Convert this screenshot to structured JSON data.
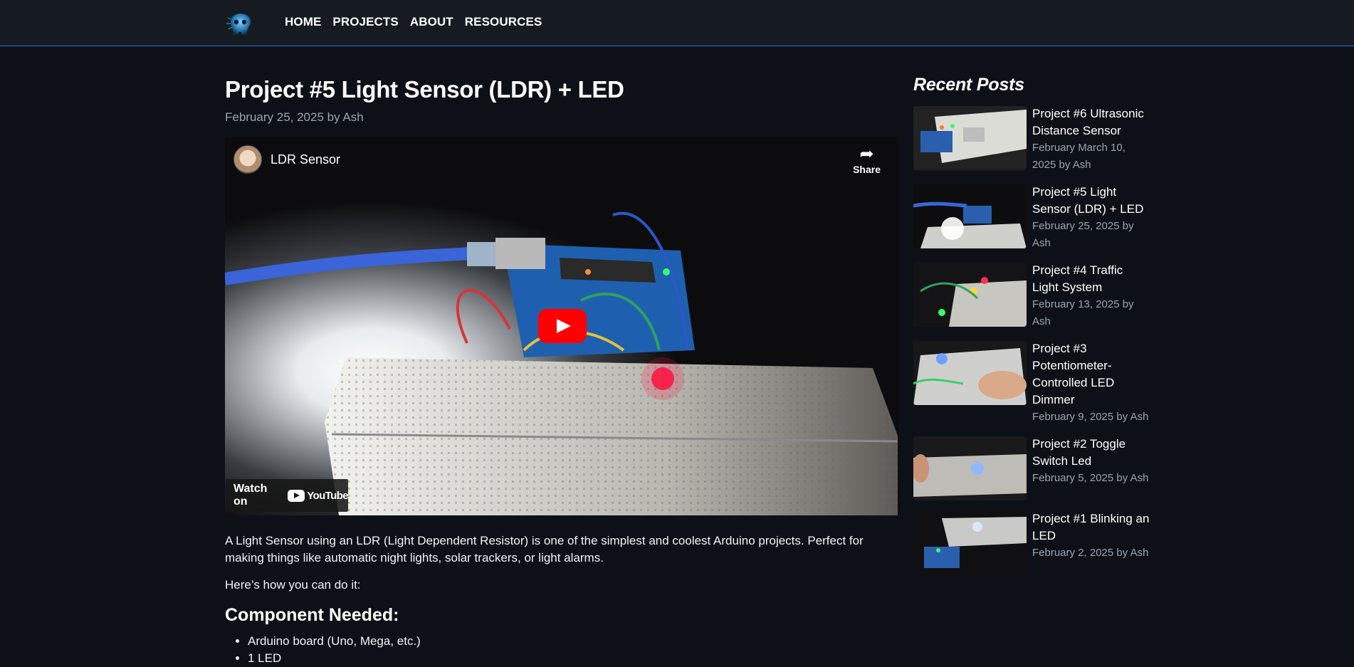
{
  "nav": {
    "logo_icon": "skull-logo-icon",
    "links": [
      "HOME",
      "PROJECTS",
      "ABOUT",
      "RESOURCES"
    ]
  },
  "post": {
    "title": "Project #5 Light Sensor (LDR) + LED",
    "meta": "February 25, 2025 by Ash",
    "video": {
      "title": "LDR Sensor",
      "share_label": "Share",
      "share_icon": "share-arrow-icon",
      "play_icon": "play-icon",
      "watch_on_label": "Watch on",
      "youtube_label": "YouTube"
    },
    "intro": "A Light Sensor using an LDR (Light Dependent Resistor) is one of the simplest and coolest Arduino projects. Perfect for making things like automatic night lights, solar trackers, or light alarms.",
    "how_to": "Here’s how you can do it:",
    "components_heading": "Component Needed:",
    "components": [
      "Arduino board (Uno, Mega, etc.)",
      "1 LED"
    ]
  },
  "sidebar": {
    "title": "Recent Posts",
    "items": [
      {
        "title": "Project #6 Ultrasonic Distance Sensor",
        "meta": "February March 10, 2025 by Ash"
      },
      {
        "title": "Project #5 Light Sensor (LDR) + LED",
        "meta": "February 25, 2025 by Ash"
      },
      {
        "title": "Project #4 Traffic Light System",
        "meta": "February 13, 2025 by Ash"
      },
      {
        "title": "Project #3 Potentiometer-Controlled LED Dimmer",
        "meta": "February 9, 2025 by Ash"
      },
      {
        "title": "Project #2 Toggle Switch Led",
        "meta": "February 5, 2025 by Ash"
      },
      {
        "title": "Project #1 Blinking an LED",
        "meta": "February 2, 2025 by Ash"
      }
    ]
  }
}
